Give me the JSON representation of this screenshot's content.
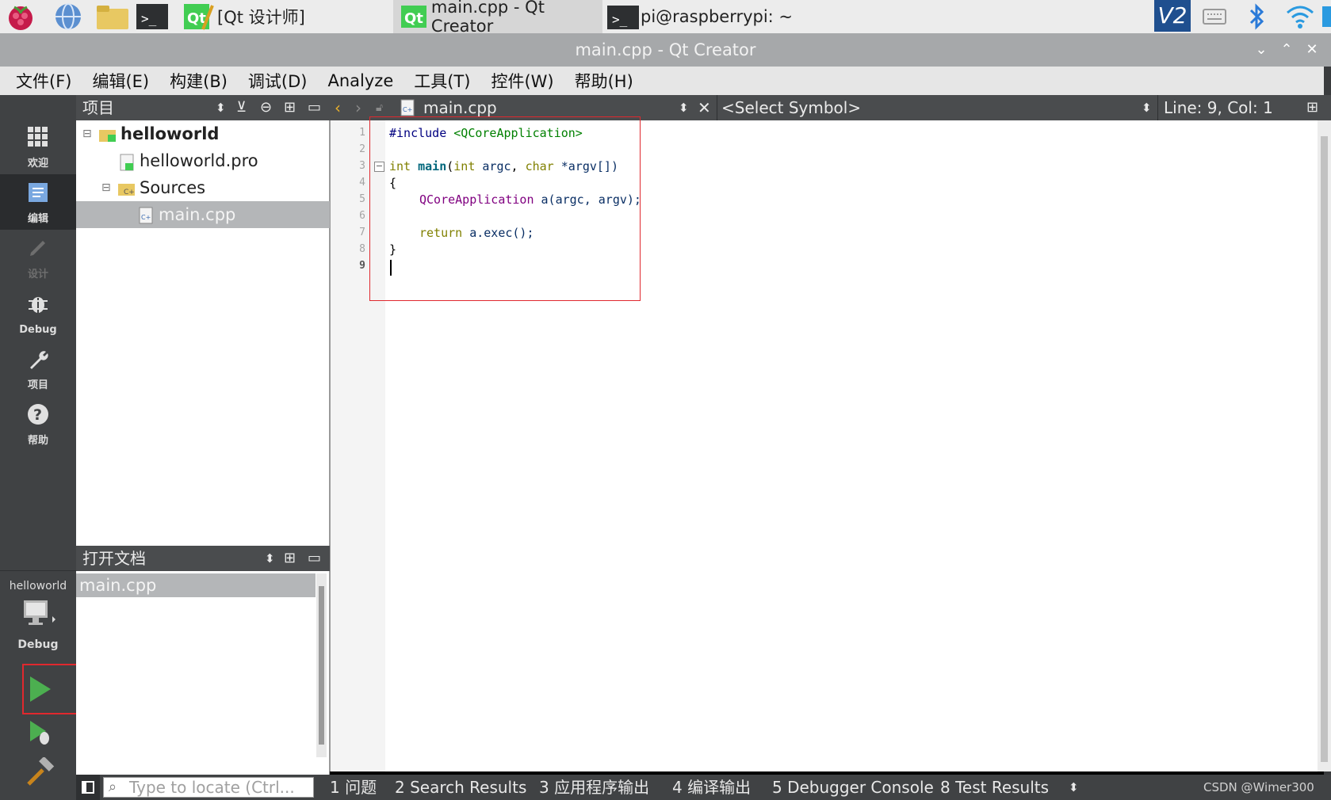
{
  "taskbar": {
    "tasks": [
      {
        "label": "[Qt 设计师]"
      },
      {
        "label": "main.cpp - Qt Creator"
      },
      {
        "label": "pi@raspberrypi: ~"
      }
    ],
    "tray_badge": "V2"
  },
  "window": {
    "title": "main.cpp - Qt Creator"
  },
  "menu": {
    "items": [
      "文件(F)",
      "编辑(E)",
      "构建(B)",
      "调试(D)",
      "Analyze",
      "工具(T)",
      "控件(W)",
      "帮助(H)"
    ]
  },
  "modes": {
    "welcome": "欢迎",
    "edit": "编辑",
    "design": "设计",
    "debug": "Debug",
    "projects": "项目",
    "help": "帮助"
  },
  "kit": {
    "project": "helloworld",
    "build": "Debug"
  },
  "projects_pane": {
    "title": "项目",
    "tree": [
      {
        "label": "helloworld"
      },
      {
        "label": "helloworld.pro"
      },
      {
        "label": "Sources"
      },
      {
        "label": "main.cpp"
      }
    ]
  },
  "open_docs_pane": {
    "title": "打开文档",
    "items": [
      "main.cpp"
    ]
  },
  "editor": {
    "file": "main.cpp",
    "symbol": "<Select Symbol>",
    "position": "Line: 9, Col: 1",
    "line_numbers": [
      "1",
      "2",
      "3",
      "4",
      "5",
      "6",
      "7",
      "8",
      "9"
    ],
    "code": {
      "l1_pp": "#include",
      "l1_inc": "<QCoreApplication>",
      "l3_kw1": "int",
      "l3_fn": "main",
      "l3_p1": "(",
      "l3_kw2": "int",
      "l3_v1": "argc",
      "l3_p2": ",",
      "l3_kw3": "char",
      "l3_v2": "*argv[])",
      "l4": "{",
      "l5_ty": "QCoreApplication",
      "l5_rest": "a(argc, argv);",
      "l7_kw": "return",
      "l7_rest": "a.exec();",
      "l8": "}"
    }
  },
  "locator": {
    "placeholder": "Type to locate (Ctrl..."
  },
  "output_tabs": [
    "1 问题",
    "2 Search Results",
    "3 应用程序输出",
    "4 编译输出",
    "5 Debugger Console",
    "8 Test Results"
  ],
  "watermark": "CSDN @Wimer300",
  "colors": {
    "highlight_box": "#e0282e",
    "mode_bar": "#404244",
    "run_green": "#4caf50"
  }
}
